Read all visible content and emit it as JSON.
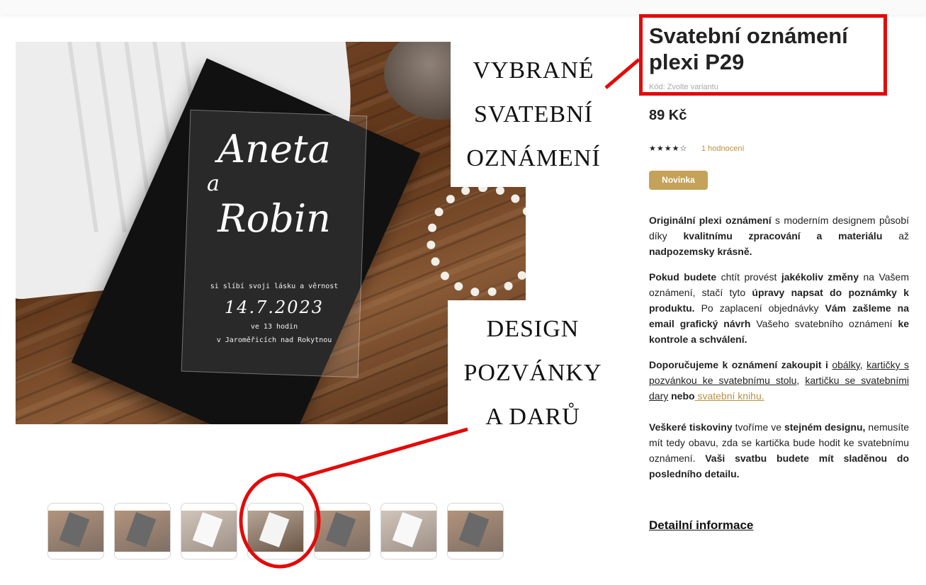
{
  "product": {
    "title_line1": "Svatební oznámení",
    "title_line2": "plexi P29",
    "code": "Kód: Zvolte variantu",
    "price": "89 Kč",
    "rating_stars": "★★★★☆",
    "rating_value": 4,
    "rating_count": "1 hodnocení",
    "badge": "Novinka"
  },
  "photo": {
    "name_line1": "Aneta",
    "name_line2": "a",
    "name_line3": "Robin",
    "promise": "si slíbí svoji lásku a věrnost",
    "date": "14.7.2023",
    "time": "ve 13 hodin",
    "place": "v Jaroměřicích nad Rokytnou"
  },
  "overlays": {
    "top": [
      "VYBRANÉ",
      "SVATEBNÍ",
      "OZNÁMENÍ"
    ],
    "bottom": [
      "DESIGN",
      "POZVÁNKY",
      "A DARŮ"
    ]
  },
  "description": {
    "p1": [
      {
        "t": "Originální plexi oznámení",
        "b": true
      },
      {
        "t": " s moderním designem působí díky ",
        "b": false
      },
      {
        "t": "kvalitnímu zpracování a materiálu",
        "b": true
      },
      {
        "t": " až ",
        "b": false
      },
      {
        "t": "nadpozemsky krásně.",
        "b": true
      }
    ],
    "p2": [
      {
        "t": "Pokud budete",
        "b": true
      },
      {
        "t": " chtít provést ",
        "b": false
      },
      {
        "t": "jakékoliv změny",
        "b": true
      },
      {
        "t": " na Vašem oznámení, stačí tyto ",
        "b": false
      },
      {
        "t": "úpravy napsat do poznámky k produktu.",
        "b": true
      },
      {
        "t": " Po zaplacení objednávky ",
        "b": false
      },
      {
        "t": "Vám zašleme na email grafický návrh",
        "b": true
      },
      {
        "t": " Vašeho svatebního oznámení ",
        "b": false
      },
      {
        "t": "ke kontrole a schválení.",
        "b": true
      }
    ],
    "p3_lead": "Doporučujeme k oznámení zakoupit i",
    "p3_link1": "obálky",
    "p3_sep1": ",",
    "p3_link2": "kartičky s pozvánkou ke svatebnímu stolu",
    "p3_sep2": ",",
    "p3_link3": "kartičku se svatebními dary",
    "p3_and": "nebo",
    "p3_link4": " svatební knihu.",
    "p4": [
      {
        "t": "Veškeré tiskoviny",
        "b": true
      },
      {
        "t": " tvoříme ve ",
        "b": false
      },
      {
        "t": "stejném designu,",
        "b": true
      },
      {
        "t": " nemusíte mít tedy obavu, zda se kartička bude hodit ke svatebnímu oznámení. ",
        "b": false
      },
      {
        "t": "Vaši svatbu budete mít sladěnou do posledního detailu.",
        "b": true
      }
    ]
  },
  "detail_link": "Detailní informace",
  "thumbnails": [
    {
      "name": "thumb-1",
      "style": "dark"
    },
    {
      "name": "thumb-2",
      "style": "dark"
    },
    {
      "name": "thumb-3",
      "style": "light"
    },
    {
      "name": "thumb-4",
      "style": "light"
    },
    {
      "name": "thumb-5",
      "style": "dark"
    },
    {
      "name": "thumb-6",
      "style": "light"
    },
    {
      "name": "thumb-7",
      "style": "dark"
    }
  ],
  "colors": {
    "accent_gold": "#c4a259",
    "annotation_red": "#e20a0a"
  }
}
